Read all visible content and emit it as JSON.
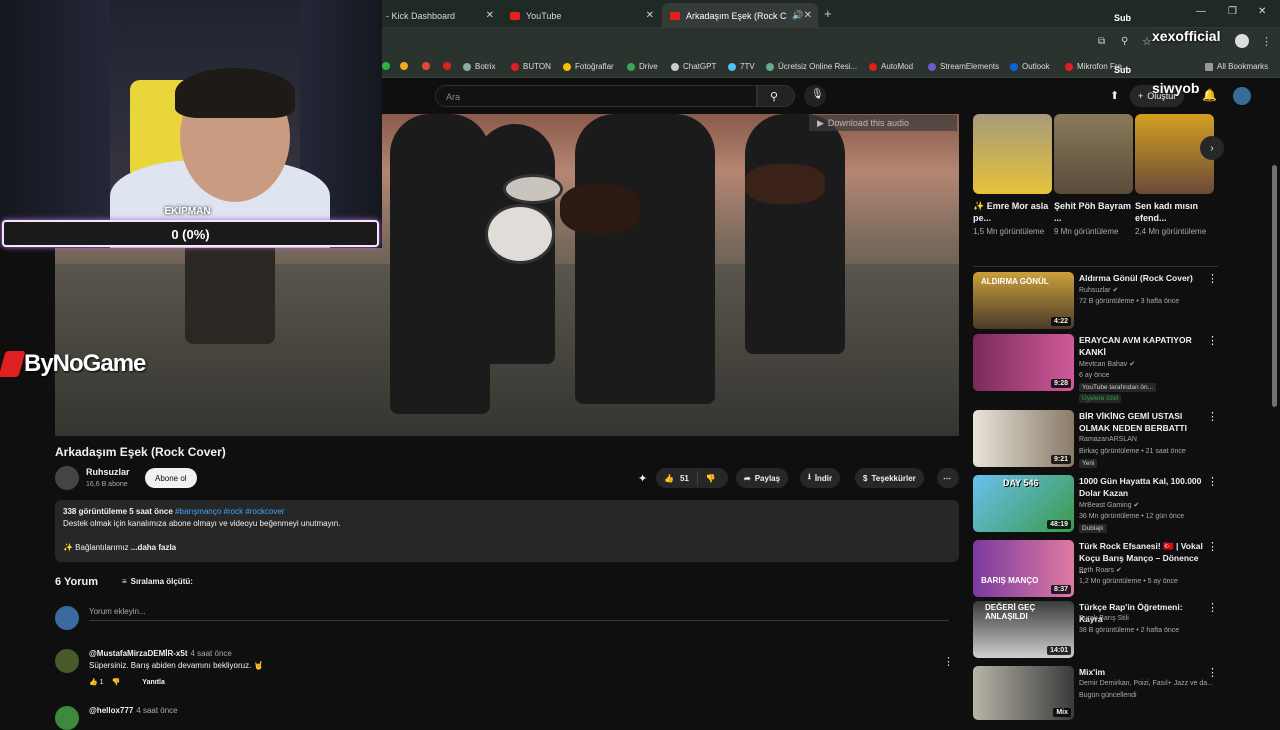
{
  "browser": {
    "tabs": [
      {
        "label": "- Kick Dashboard"
      },
      {
        "label": "YouTube"
      },
      {
        "label": "Arkadaşım Eşek (Rock Cover)"
      }
    ],
    "bookmarks": [
      {
        "label": "Botrix"
      },
      {
        "label": "BUTON"
      },
      {
        "label": "Fotoğraflar"
      },
      {
        "label": "Drive"
      },
      {
        "label": "ChatGPT"
      },
      {
        "label": "7TV"
      },
      {
        "label": "Ücretsiz Online Resi..."
      },
      {
        "label": "AutoMod"
      },
      {
        "label": "StreamElements"
      },
      {
        "label": "Outlook"
      },
      {
        "label": "Mikrofon Fre..."
      },
      {
        "label": "All Bookmarks"
      }
    ]
  },
  "youtube": {
    "search_placeholder": "Ara",
    "create_label": "Oluştur"
  },
  "video": {
    "download_label": "Download this audio",
    "title": "Arkadaşım Eşek (Rock Cover)",
    "channel": "Ruhsuzlar",
    "subs": "16,6 B abone",
    "subscribe": "Abone ol",
    "likes": "51",
    "share": "Paylaş",
    "download": "İndir",
    "thanks": "Teşekkürler",
    "desc_views": "338 görüntüleme  5 saat önce",
    "desc_tags": "#barışmanço #rock #rockcover",
    "desc_text": "Destek olmak için kanalımıza abone olmayı ve videoyu beğenmeyi unutmayın.",
    "desc_links": "✨ Bağlantılarımız",
    "desc_more": "...daha fazla"
  },
  "comments": {
    "header": "6 Yorum",
    "sort": "Sıralama ölçütü:",
    "add_placeholder": "Yorum ekleyin...",
    "items": [
      {
        "user": "@MustafaMirzaDEMİR-x5t",
        "time": "4 saat önce",
        "text": "Süpersiniz. Barış abiden devamını bekliyoruz. 🤘",
        "likes": "1",
        "reply": "Yanıtla"
      },
      {
        "user": "@hellox777",
        "time": "4 saat önce"
      }
    ]
  },
  "shorts": [
    {
      "title": "✨ Emre Mor asla pe...",
      "views": "1,5 Mn görüntüleme"
    },
    {
      "title": "Şehit Pöh Bayram ...",
      "views": "9 Mn görüntüleme"
    },
    {
      "title": "Sen kadı mısın efend...",
      "views": "2,4 Mn görüntüleme"
    }
  ],
  "recommendations": [
    {
      "title": "Aldırma Gönül (Rock Cover)",
      "channel": "Ruhsuzlar",
      "meta": "72 B görüntüleme • 3 hafta önce",
      "duration": "4:22",
      "thumb_text": "ALDIRMA GÖNÜL"
    },
    {
      "title": "ERAYCAN AVM KAPATIYOR KANKİ",
      "channel": "Mevtcan Bahav",
      "meta": "6 ay önce",
      "badge1": "YouTube tarafından ön...",
      "badge2": "Üyelere özel",
      "duration": "9:28"
    },
    {
      "title": "BİR VİKİNG GEMİ USTASI OLMAK NEDEN BERBATTI",
      "channel": "RamazanARSLAN",
      "meta": "Birkaç görüntüleme • 21 saat önce",
      "badge1": "Yeni",
      "duration": "9:21"
    },
    {
      "title": "1000 Gün Hayatta Kal, 100.000 Dolar Kazan",
      "channel": "MrBeast Gaming",
      "meta": "36 Mn görüntüleme • 12 gün önce",
      "badge1": "Dublajlı",
      "duration": "48:19",
      "thumb_text": "DAY 546"
    },
    {
      "title": "Türk Rock Efsanesi! 🇹🇷 | Vokal Koçu Barış Manço – Dönence ...",
      "channel": "Beth Roars",
      "meta": "1,2 Mn görüntüleme • 5 ay önce",
      "duration": "8:37",
      "thumb_text": "BARIŞ MANÇO"
    },
    {
      "title": "Türkçe Rap'in Öğretmeni: Kayra",
      "channel": "Burak Barış Stili",
      "meta": "38 B görüntüleme • 2 hafta önce",
      "duration": "14:01",
      "thumb_text": "DEĞERİ GEÇ ANLAŞILDI"
    },
    {
      "title": "Mix'im",
      "channel": "Demir Demirkan, Poizi, Fasıl+ Jazz ve da...",
      "meta": "Bugün güncellendi",
      "duration": "Mix"
    }
  ],
  "overlay": {
    "goal_label": "EKİPMAN",
    "goal_value": "0 (0%)",
    "goal_progress": 0,
    "sponsor": "ByNoGame",
    "sub1_label": "Sub",
    "sub1_name": "xexofficial",
    "sub2_label": "Sub",
    "sub2_name": "siwyob"
  }
}
